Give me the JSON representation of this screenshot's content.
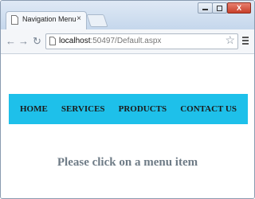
{
  "browser": {
    "tab_title": "Navigation Menu",
    "tab_close": "×",
    "url_host": "localhost",
    "url_rest": ":50497/Default.aspx",
    "window_close": "X"
  },
  "nav_menu": {
    "items": [
      {
        "label": "HOME"
      },
      {
        "label": "SERVICES"
      },
      {
        "label": "PRODUCTS"
      },
      {
        "label": "CONTACT US"
      }
    ],
    "background_color": "#1ec0ea"
  },
  "main": {
    "message": "Please click on a menu item"
  }
}
